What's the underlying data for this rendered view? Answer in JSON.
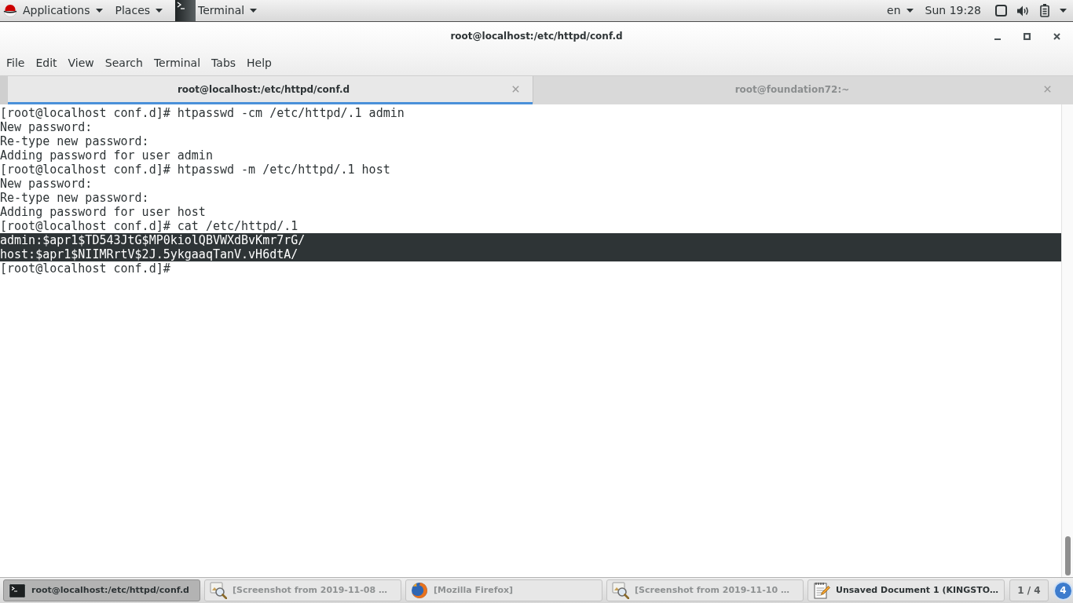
{
  "top_bar": {
    "applications_menu": "Applications",
    "places_menu": "Places",
    "app_menu": "Terminal",
    "keyboard_layout": "en",
    "clock": "Sun 19:28"
  },
  "window": {
    "title": "root@localhost:/etc/httpd/conf.d"
  },
  "menu_bar": [
    "File",
    "Edit",
    "View",
    "Search",
    "Terminal",
    "Tabs",
    "Help"
  ],
  "tabs": [
    {
      "label": "root@localhost:/etc/httpd/conf.d",
      "selected": true
    },
    {
      "label": "root@foundation72:~",
      "selected": false
    }
  ],
  "terminal": {
    "lines": [
      {
        "text": "[root@localhost conf.d]# htpasswd -cm /etc/httpd/.1 admin",
        "selected": false
      },
      {
        "text": "New password:",
        "selected": false
      },
      {
        "text": "Re-type new password:",
        "selected": false
      },
      {
        "text": "Adding password for user admin",
        "selected": false
      },
      {
        "text": "[root@localhost conf.d]# htpasswd -m /etc/httpd/.1 host",
        "selected": false
      },
      {
        "text": "New password:",
        "selected": false
      },
      {
        "text": "Re-type new password:",
        "selected": false
      },
      {
        "text": "Adding password for user host",
        "selected": false
      },
      {
        "text": "[root@localhost conf.d]# cat /etc/httpd/.1",
        "selected": false
      },
      {
        "text": "admin:$apr1$TD543JtG$MP0kiolQBVWXdBvKmr7rG/",
        "selected": true
      },
      {
        "text": "host:$apr1$NIIMRrtV$2J.5ykgaaqTanV.vH6dtA/",
        "selected": true
      },
      {
        "text": "[root@localhost conf.d]#",
        "selected": false
      }
    ]
  },
  "taskbar": {
    "items": [
      {
        "label": "root@localhost:/etc/httpd/conf.d",
        "kind": "terminal",
        "selected": true,
        "minimized": false
      },
      {
        "label": "[Screenshot from 2019-11-08 …",
        "kind": "image_viewer",
        "selected": false,
        "minimized": true
      },
      {
        "label": "[Mozilla Firefox]",
        "kind": "browser",
        "selected": false,
        "minimized": true
      },
      {
        "label": "[Screenshot from 2019-11-10 …",
        "kind": "image_viewer",
        "selected": false,
        "minimized": true
      },
      {
        "label": "Unsaved Document 1 (KINGSTO…",
        "kind": "text_editor",
        "selected": false,
        "minimized": false
      }
    ],
    "workspace": "1 / 4",
    "notification_count": "4"
  }
}
